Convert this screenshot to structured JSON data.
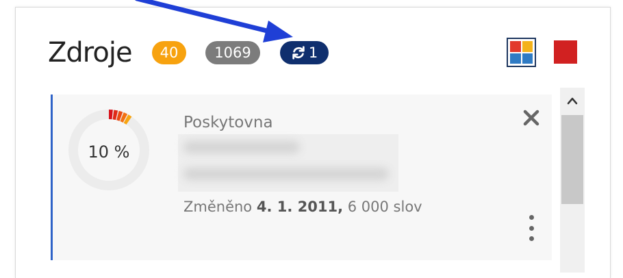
{
  "header": {
    "title": "Zdroje",
    "badges": {
      "orange": "40",
      "gray": "1069",
      "sync_count": "1"
    }
  },
  "view_toggles": {
    "grid_icon": "grid-view-icon",
    "red_icon": "red-square-icon"
  },
  "card": {
    "progress_text": "10 %",
    "progress_value": 0.1,
    "title": "Poskytovna",
    "meta_prefix": "Změněno",
    "meta_date": "4. 1. 2011,",
    "meta_words": "6 000 slov"
  },
  "colors": {
    "accent_blue": "#0f2f6e",
    "badge_orange": "#f7a20f",
    "badge_gray": "#7c7c7c",
    "card_border": "#2f63c8",
    "annotation_arrow": "#1f3fd6"
  }
}
